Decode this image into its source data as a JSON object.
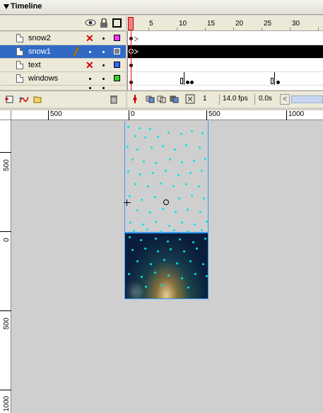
{
  "panel": {
    "title": "Timeline"
  },
  "layers": [
    {
      "name": "snow2",
      "hidden": true,
      "color": "#ff33ff",
      "selected": false
    },
    {
      "name": "snow1",
      "hidden": false,
      "color": "#808080",
      "selected": true
    },
    {
      "name": "text",
      "hidden": true,
      "color": "#3366ff",
      "selected": false
    },
    {
      "name": "windows",
      "hidden": false,
      "color": "#33cc33",
      "selected": false
    }
  ],
  "ruler": {
    "marks": [
      "1",
      "5",
      "10",
      "15",
      "20",
      "25",
      "30"
    ]
  },
  "timeline_toolbar": {
    "current_frame": "1",
    "frame_rate": "14.0 fps",
    "elapsed_time": "0.0s"
  },
  "stage_ruler": {
    "horizontal": [
      "500",
      "0",
      "500",
      "1000"
    ],
    "vertical": [
      "500",
      "0",
      "500",
      "1000"
    ]
  },
  "colors": {
    "selection": "#316ac5",
    "snow": "#00e5e5",
    "bounding_box": "#3399ff"
  }
}
